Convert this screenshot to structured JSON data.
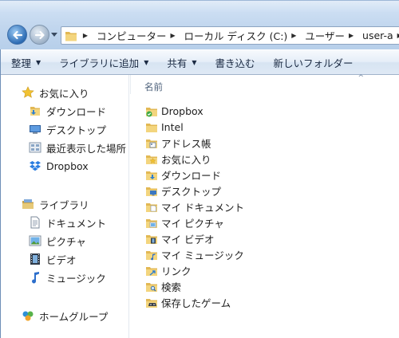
{
  "address_bar": {
    "breadcrumbs": [
      {
        "label": "コンピューター"
      },
      {
        "label": "ローカル ディスク (C:)"
      },
      {
        "label": "ユーザー"
      },
      {
        "label": "user-a"
      }
    ]
  },
  "command_bar": {
    "organize": "整理",
    "include_in_library": "ライブラリに追加",
    "share": "共有",
    "burn": "書き込む",
    "new_folder": "新しいフォルダー"
  },
  "nav_pane": {
    "favorites": {
      "label": "お気に入り",
      "items": [
        {
          "label": "ダウンロード",
          "icon": "download-folder-icon"
        },
        {
          "label": "デスクトップ",
          "icon": "desktop-icon"
        },
        {
          "label": "最近表示した場所",
          "icon": "recent-places-icon"
        },
        {
          "label": "Dropbox",
          "icon": "dropbox-icon"
        }
      ]
    },
    "libraries": {
      "label": "ライブラリ",
      "items": [
        {
          "label": "ドキュメント",
          "icon": "documents-icon"
        },
        {
          "label": "ピクチャ",
          "icon": "pictures-icon"
        },
        {
          "label": "ビデオ",
          "icon": "videos-icon"
        },
        {
          "label": "ミュージック",
          "icon": "music-icon"
        }
      ]
    },
    "homegroup": {
      "label": "ホームグループ"
    }
  },
  "file_list": {
    "column_name": "名前",
    "items": [
      {
        "label": "Dropbox",
        "icon": "dropbox-folder-icon"
      },
      {
        "label": "Intel",
        "icon": "folder-icon"
      },
      {
        "label": "アドレス帳",
        "icon": "contacts-folder-icon"
      },
      {
        "label": "お気に入り",
        "icon": "favorites-folder-icon"
      },
      {
        "label": "ダウンロード",
        "icon": "downloads-folder-icon"
      },
      {
        "label": "デスクトップ",
        "icon": "desktop-folder-icon"
      },
      {
        "label": "マイ ドキュメント",
        "icon": "documents-folder-icon"
      },
      {
        "label": "マイ ピクチャ",
        "icon": "pictures-folder-icon"
      },
      {
        "label": "マイ ビデオ",
        "icon": "videos-folder-icon"
      },
      {
        "label": "マイ ミュージック",
        "icon": "music-folder-icon"
      },
      {
        "label": "リンク",
        "icon": "links-folder-icon"
      },
      {
        "label": "検索",
        "icon": "searches-folder-icon"
      },
      {
        "label": "保存したゲーム",
        "icon": "saved-games-folder-icon"
      }
    ]
  },
  "colors": {
    "folder": "#e9c46a",
    "accent": "#2d6cb4",
    "header_text": "#4c607a"
  }
}
